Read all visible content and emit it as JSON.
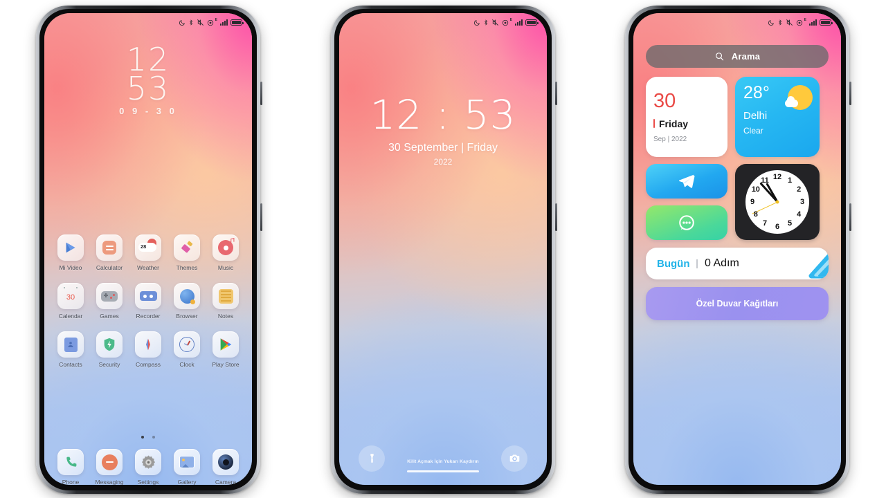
{
  "statusbar": {
    "icons": [
      "moon-dnd-icon",
      "bluetooth-icon",
      "mute-vibrate-icon",
      "screen-recorder-icon",
      "signal-bars-icon",
      "battery-icon"
    ],
    "network_label": "E"
  },
  "phone1": {
    "name": "Home Screen",
    "clock": {
      "hours": "12",
      "minutes": "53",
      "date": "0 9 - 3 0"
    },
    "rows": [
      [
        {
          "label": "Mi Video",
          "icon": "mi-video-icon"
        },
        {
          "label": "Calculator",
          "icon": "calculator-icon"
        },
        {
          "label": "Weather",
          "icon": "weather-icon",
          "badge": "28"
        },
        {
          "label": "Themes",
          "icon": "themes-icon"
        },
        {
          "label": "Music",
          "icon": "music-icon"
        }
      ],
      [
        {
          "label": "Calendar",
          "icon": "calendar-icon",
          "badge": "30"
        },
        {
          "label": "Games",
          "icon": "games-icon"
        },
        {
          "label": "Recorder",
          "icon": "recorder-icon"
        },
        {
          "label": "Browser",
          "icon": "browser-icon"
        },
        {
          "label": "Notes",
          "icon": "notes-icon"
        }
      ],
      [
        {
          "label": "Contacts",
          "icon": "contacts-icon"
        },
        {
          "label": "Security",
          "icon": "security-icon"
        },
        {
          "label": "Compass",
          "icon": "compass-icon"
        },
        {
          "label": "Clock",
          "icon": "clock-icon"
        },
        {
          "label": "Play Store",
          "icon": "play-store-icon"
        }
      ],
      [
        {
          "label": "Phone",
          "icon": "phone-icon"
        },
        {
          "label": "Messaging",
          "icon": "messaging-icon"
        },
        {
          "label": "Settings",
          "icon": "settings-icon"
        },
        {
          "label": "Gallery",
          "icon": "gallery-icon"
        },
        {
          "label": "Camera",
          "icon": "camera-icon"
        }
      ]
    ],
    "page_dots": 2,
    "active_dot": 0
  },
  "phone2": {
    "name": "Lock Screen",
    "time": "12 : 53",
    "date": "30 September | Friday",
    "year": "2022",
    "unlock_hint": "Kilit Açmak İçin Yukarı Kaydırın",
    "left_shortcut": "flashlight-icon",
    "right_shortcut": "camera-icon"
  },
  "phone3": {
    "name": "Widgets Screen",
    "search": {
      "label": "Arama",
      "icon": "search-icon"
    },
    "calendar_widget": {
      "day_number": "30",
      "weekday": "Friday",
      "month_year": "Sep | 2022",
      "accent": "#ea4b47"
    },
    "weather_widget": {
      "temperature": "28",
      "degree": "°",
      "city": "Delhi",
      "condition": "Clear",
      "icon": "sun-behind-cloud-icon",
      "accent": "#26b7f2"
    },
    "telegram_tile": {
      "icon": "telegram-icon",
      "accent": "#22a8f0"
    },
    "messages_tile": {
      "icon": "chat-bubble-icon",
      "accent": "#4ad89a"
    },
    "clock_widget": {
      "numerals": [
        "12",
        "1",
        "2",
        "3",
        "4",
        "5",
        "6",
        "7",
        "8",
        "9",
        "10",
        "11"
      ],
      "hour_angle": -30,
      "minute_angle": 318,
      "second_angle": 245,
      "second_hand_color": "#f0c020",
      "face_bg": "#232326"
    },
    "steps_widget": {
      "today_label": "Bugün",
      "value": "0 Adım",
      "accent": "#21b3e8",
      "icon": "shoe-icon"
    },
    "wallpaper_widget": {
      "label": "Özel Duvar Kağıtları",
      "accent": "#9a91ef"
    }
  }
}
